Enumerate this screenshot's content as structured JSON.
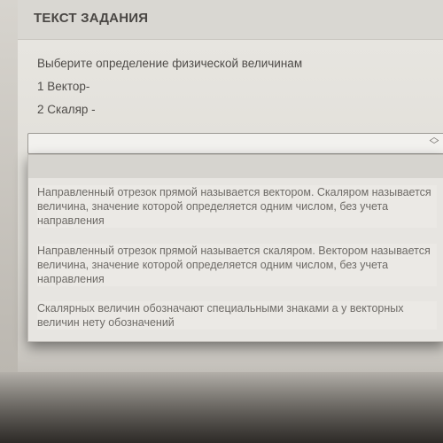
{
  "header": {
    "title": "ТЕКСТ ЗАДАНИЯ"
  },
  "question": {
    "prompt": "Выберите определение физической величинам",
    "item1": "1 Вектор-",
    "item2": "2 Скаляр -"
  },
  "select": {
    "value": ""
  },
  "dropdown": {
    "options": [
      "Направленный отрезок прямой называется вектором. Скаляром называется величина, значение которой определяется одним числом, без учета направления",
      "Направленный отрезок прямой называется скаляром. Вектором называется величина, значение которой определяется одним числом, без учета направления",
      "Скалярных величин обозначают специальными знаками а у векторных величин нету обозначений"
    ]
  }
}
